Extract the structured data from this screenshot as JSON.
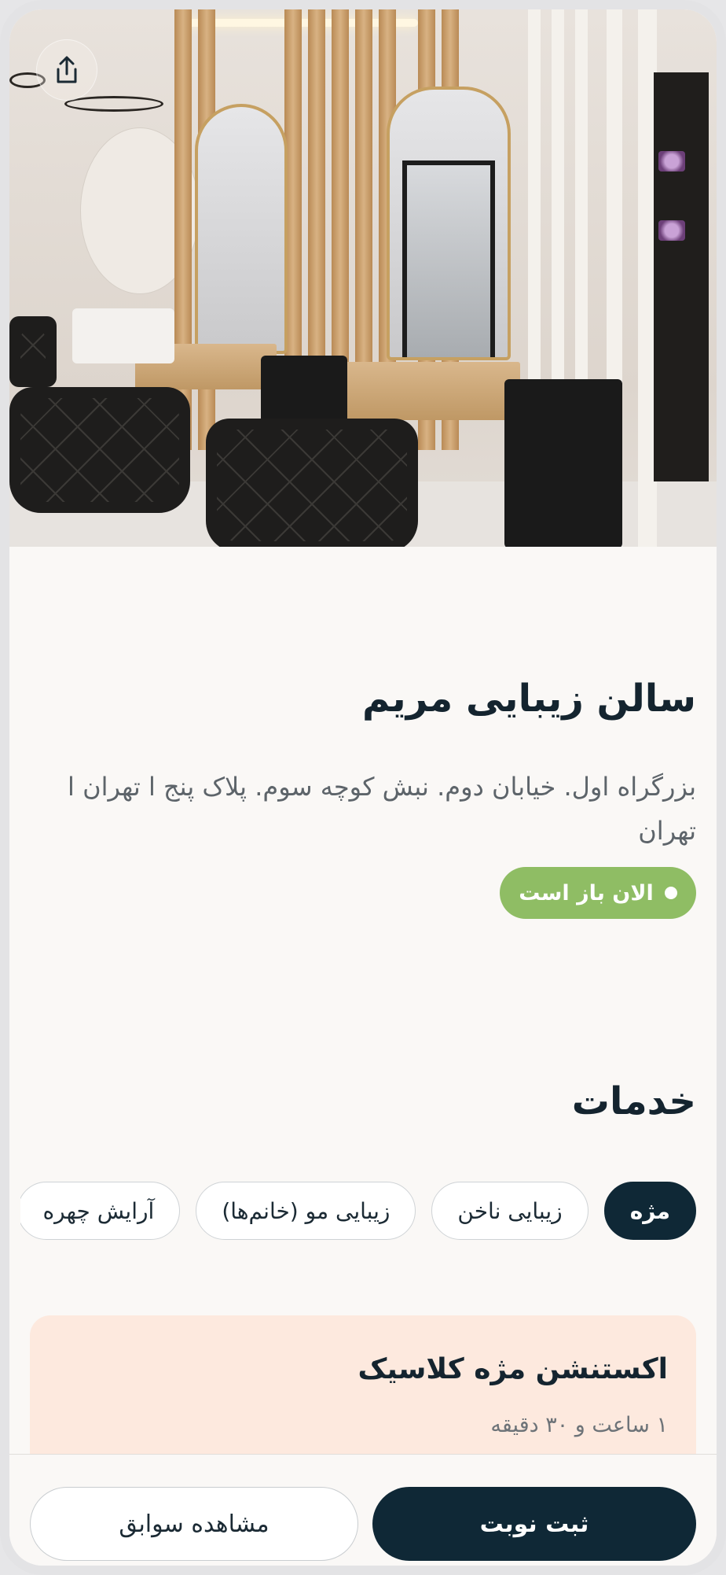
{
  "hero": {
    "alt": "salon interior photo",
    "share_icon": "share-icon"
  },
  "salon": {
    "name": "سالن زیبایی مریم",
    "address": "بزرگراه اول. خیابان دوم. نبش کوچه سوم. پلاک پنج ا تهران ا تهران",
    "status": "الان باز است",
    "status_color": "#8fbd64"
  },
  "services": {
    "title": "خدمات",
    "chips": [
      {
        "label": "مژه",
        "active": true
      },
      {
        "label": "زیبایی ناخن",
        "active": false
      },
      {
        "label": "زیبایی مو (خانم‌ها)",
        "active": false
      },
      {
        "label": "آرایش چهره",
        "active": false
      }
    ],
    "card": {
      "name": "اکستنشن مژه کلاسیک",
      "duration": "۱ ساعت و ۳۰ دقیقه"
    }
  },
  "actions": {
    "book": "ثبت نوبت",
    "history": "مشاهده سوابق"
  },
  "colors": {
    "primary": "#0f2836",
    "card_bg": "#fde9de",
    "page_bg": "#faf8f6"
  }
}
